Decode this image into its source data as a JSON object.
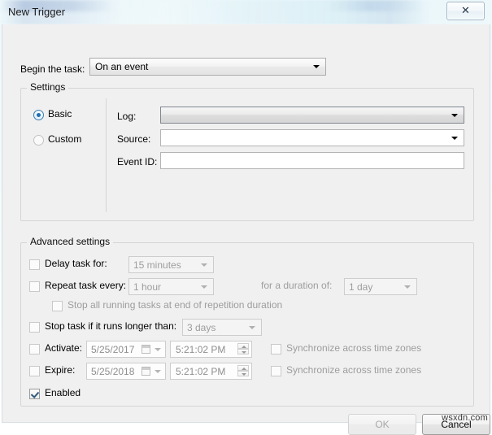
{
  "window": {
    "title": "New Trigger",
    "close_icon": "close-icon",
    "close_glyph": "✕"
  },
  "begin": {
    "label": "Begin the task:",
    "value": "On an event"
  },
  "settings": {
    "title": "Settings",
    "mode": {
      "basic_label": "Basic",
      "custom_label": "Custom",
      "selected": "Basic"
    },
    "fields": {
      "log_label": "Log:",
      "log_value": "",
      "source_label": "Source:",
      "source_value": "",
      "eventid_label": "Event ID:",
      "eventid_value": "",
      "eventid_placeholder": ""
    }
  },
  "advanced": {
    "title": "Advanced settings",
    "delay": {
      "label": "Delay task for:",
      "checked": false,
      "value": "15 minutes"
    },
    "repeat": {
      "label": "Repeat task every:",
      "checked": false,
      "value": "1 hour",
      "duration_label": "for a duration of:",
      "duration_value": "1 day"
    },
    "stop_at_end": {
      "label": "Stop all running tasks at end of repetition duration",
      "checked": false
    },
    "stop_longer": {
      "label": "Stop task if it runs longer than:",
      "checked": false,
      "value": "3 days"
    },
    "activate": {
      "label": "Activate:",
      "checked": false,
      "date": "5/25/2017",
      "time": "5:21:02 PM",
      "sync_label": "Synchronize across time zones",
      "sync_checked": false
    },
    "expire": {
      "label": "Expire:",
      "checked": false,
      "date": "5/25/2018",
      "time": "5:21:02 PM",
      "sync_label": "Synchronize across time zones",
      "sync_checked": false
    },
    "enabled": {
      "label": "Enabled",
      "checked": true
    }
  },
  "buttons": {
    "ok": "OK",
    "cancel": "Cancel"
  },
  "watermark": "wsxdn.com"
}
